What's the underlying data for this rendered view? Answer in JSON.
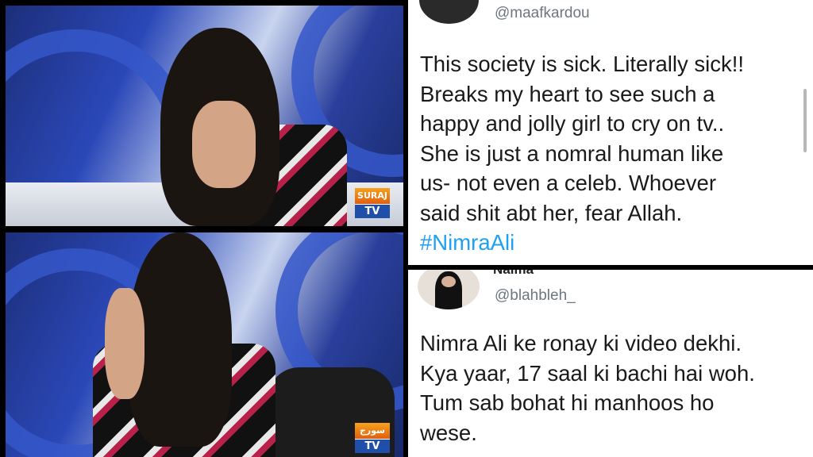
{
  "still_top": {
    "logo_line1": "SURAJ",
    "logo_line2": "TV"
  },
  "still_bottom": {
    "logo_line1": "سورج",
    "logo_line2": "TV"
  },
  "tweet1": {
    "handle": "@maafkardou",
    "lines": [
      "This society is sick. Literally sick!!",
      "Breaks my heart to see such a",
      "happy and jolly girl to cry on tv..",
      "She is just a nomral human like",
      "us- not even a celeb. Whoever",
      "said shit abt her, fear Allah."
    ],
    "hashtag": "#NimraAli"
  },
  "tweet2": {
    "name_partial": "Naima",
    "handle": "@blahbleh_",
    "lines": [
      "Nimra Ali ke ronay ki video dekhi.",
      "Kya yaar, 17 saal ki bachi hai woh.",
      "Tum sab bohat hi manhoos ho",
      "wese."
    ]
  },
  "colors": {
    "studio_blue": "#2b48b8",
    "hashtag": "#1da1f2",
    "handle_grey": "#6b7781"
  }
}
